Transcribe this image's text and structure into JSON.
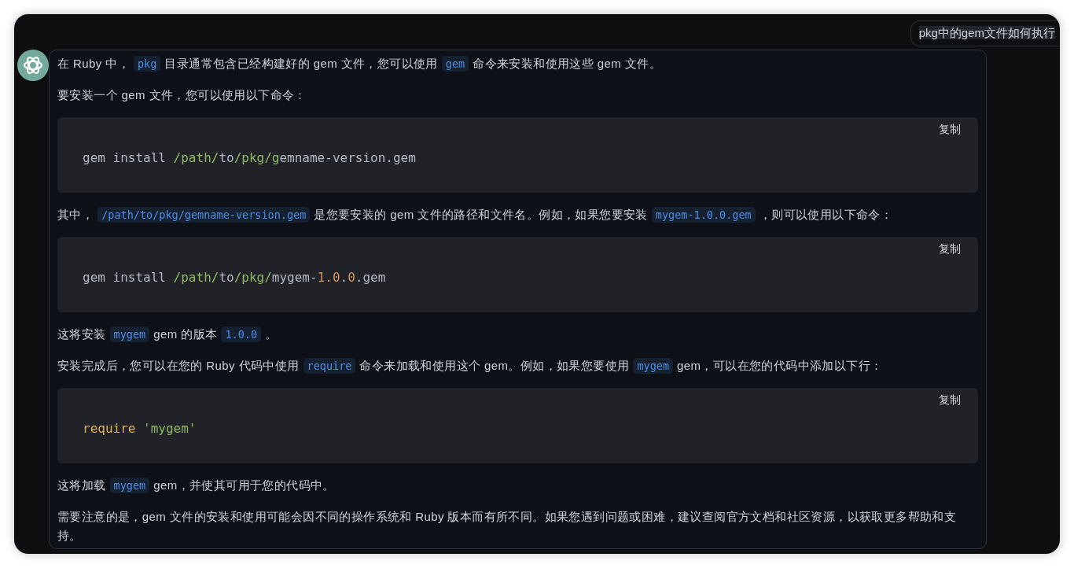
{
  "question": "pkg中的gem文件如何执行",
  "answer": [
    {
      "kind": "para",
      "parts": [
        {
          "kind": "text",
          "text": "在 Ruby 中，"
        },
        {
          "kind": "code",
          "text": "pkg"
        },
        {
          "kind": "text",
          "text": "目录通常包含已经构建好的 gem 文件，您可以使用"
        },
        {
          "kind": "code",
          "text": "gem"
        },
        {
          "kind": "text",
          "text": "命令来安装和使用这些 gem 文件。"
        }
      ]
    },
    {
      "kind": "para",
      "parts": [
        {
          "kind": "text",
          "text": "要安装一个 gem 文件，您可以使用以下命令："
        }
      ]
    },
    {
      "kind": "code",
      "copy": "复制",
      "tokens": [
        {
          "kind": "plain",
          "text": "gem install "
        },
        {
          "kind": "path",
          "text": "/path/"
        },
        {
          "kind": "plain",
          "text": "to"
        },
        {
          "kind": "path",
          "text": "/pkg/g"
        },
        {
          "kind": "plain",
          "text": "emname-version.gem"
        }
      ]
    },
    {
      "kind": "para",
      "parts": [
        {
          "kind": "text",
          "text": "其中，"
        },
        {
          "kind": "code",
          "text": "/path/to/pkg/gemname-version.gem"
        },
        {
          "kind": "text",
          "text": "是您要安装的 gem 文件的路径和文件名。例如，如果您要安装"
        },
        {
          "kind": "code",
          "text": "mygem-1.0.0.gem"
        },
        {
          "kind": "text",
          "text": "，则可以使用以下命令："
        }
      ]
    },
    {
      "kind": "code",
      "copy": "复制",
      "tokens": [
        {
          "kind": "plain",
          "text": "gem install "
        },
        {
          "kind": "path",
          "text": "/path/"
        },
        {
          "kind": "plain",
          "text": "to"
        },
        {
          "kind": "path",
          "text": "/pkg/"
        },
        {
          "kind": "plain",
          "text": "mygem-"
        },
        {
          "kind": "number",
          "text": "1.0"
        },
        {
          "kind": "plain",
          "text": "."
        },
        {
          "kind": "number",
          "text": "0"
        },
        {
          "kind": "plain",
          "text": ".gem"
        }
      ]
    },
    {
      "kind": "para",
      "parts": [
        {
          "kind": "text",
          "text": "这将安装"
        },
        {
          "kind": "code",
          "text": "mygem"
        },
        {
          "kind": "text",
          "text": "gem 的版本"
        },
        {
          "kind": "code",
          "text": "1.0.0"
        },
        {
          "kind": "text",
          "text": "。"
        }
      ]
    },
    {
      "kind": "para",
      "parts": [
        {
          "kind": "text",
          "text": "安装完成后，您可以在您的 Ruby 代码中使用"
        },
        {
          "kind": "code",
          "text": "require"
        },
        {
          "kind": "text",
          "text": "命令来加载和使用这个 gem。例如，如果您要使用"
        },
        {
          "kind": "code",
          "text": "mygem"
        },
        {
          "kind": "text",
          "text": "gem，可以在您的代码中添加以下行："
        }
      ]
    },
    {
      "kind": "code",
      "copy": "复制",
      "tokens": [
        {
          "kind": "keyword",
          "text": "require "
        },
        {
          "kind": "string",
          "text": "'mygem'"
        }
      ]
    },
    {
      "kind": "para",
      "parts": [
        {
          "kind": "text",
          "text": "这将加载"
        },
        {
          "kind": "code",
          "text": "mygem"
        },
        {
          "kind": "text",
          "text": "gem，并使其可用于您的代码中。"
        }
      ]
    },
    {
      "kind": "para",
      "parts": [
        {
          "kind": "text",
          "text": "需要注意的是，gem 文件的安装和使用可能会因不同的操作系统和 Ruby 版本而有所不同。如果您遇到问题或困难，建议查阅官方文档和社区资源，以获取更多帮助和支持。"
        }
      ]
    }
  ]
}
